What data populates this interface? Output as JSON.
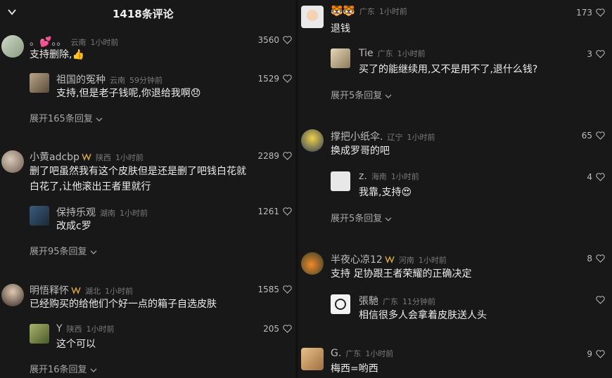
{
  "header": {
    "title": "1418条评论"
  },
  "left": [
    {
      "name": "。💕。。",
      "loc": "云南",
      "time": "1小时前",
      "likes": "3560",
      "text": "支持删除,👍",
      "reply": {
        "name": "祖国的冤种",
        "loc": "云南",
        "time": "59分钟前",
        "likes": "1529",
        "text": "支持,但是老子钱呢,你退给我啊😞"
      },
      "more": "展开165条回复"
    },
    {
      "name": "小黄adcbp",
      "loc": "陕西",
      "time": "1小时前",
      "likes": "2289",
      "text1": "删了吧虽然我有这个皮肤但是还是删了吧钱白花就",
      "text2": "白花了,让他滚出王者里就行",
      "reply": {
        "name": "保持乐观",
        "loc": "湖南",
        "time": "1小时前",
        "likes": "1261",
        "text": "改成c罗"
      },
      "more": "展开95条回复"
    },
    {
      "name": "明悟释怀",
      "loc": "湖北",
      "time": "1小时前",
      "likes": "1585",
      "text": "已经购买的给他们个好一点的箱子自选皮肤",
      "reply": {
        "name": "Y",
        "loc": "陕西",
        "time": "1小时前",
        "likes": "205",
        "text": "这个可以"
      },
      "more": "展开16条回复"
    }
  ],
  "right": [
    {
      "name": "",
      "loc": "广东",
      "time": "1小时前",
      "likes": "173",
      "text": "退钱",
      "reply": {
        "name": "Tie",
        "loc": "广东",
        "time": "1小时前",
        "likes": "3",
        "text": "买了的能继续用,又不是用不了,退什么钱?"
      },
      "more": "展开5条回复"
    },
    {
      "name": "撑把小纸伞.",
      "loc": "辽宁",
      "time": "1小时前",
      "likes": "65",
      "text": "换成罗哥的吧",
      "reply": {
        "name": "z.",
        "loc": "海南",
        "time": "1小时前",
        "likes": "4",
        "text": "我靠,支持😍"
      },
      "more": "展开5条回复"
    },
    {
      "name": "半夜心凉12",
      "loc": "河南",
      "time": "1小时前",
      "likes": "8",
      "text": "支持   足协跟王者荣耀的正确决定",
      "reply": {
        "name": "張馳",
        "loc": "广东",
        "time": "11分钟前",
        "likes": "",
        "text": "相信很多人会拿着皮肤送人头"
      },
      "more": ""
    },
    {
      "name": "G.",
      "loc": "广东",
      "time": "1小时前",
      "likes": "9",
      "text": "梅西=哟西"
    }
  ],
  "colors": {
    "bg": "#181818",
    "text": "#ececec",
    "muted": "#7a7a7a",
    "badge": "#d9a441"
  }
}
